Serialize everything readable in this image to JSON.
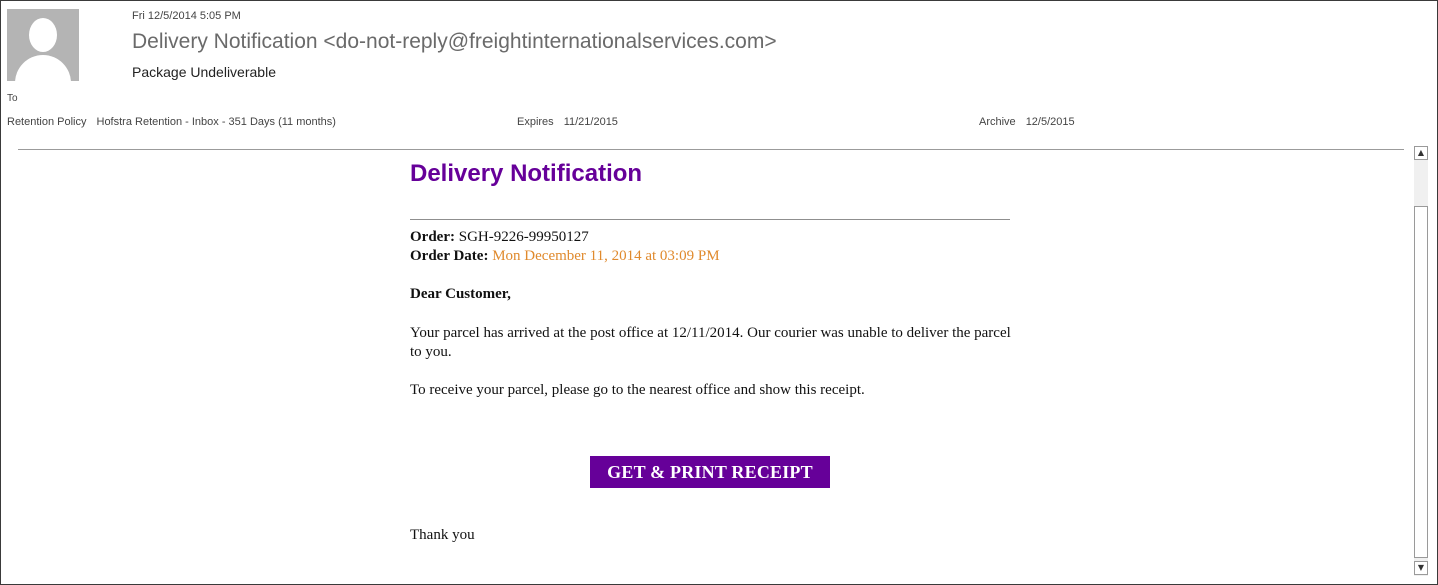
{
  "header": {
    "sent_date": "Fri 12/5/2014 5:05 PM",
    "from": "Delivery Notification <do-not-reply@freightinternationalservices.com>",
    "subject": "Package Undeliverable",
    "to_label": "To"
  },
  "meta": {
    "retention_label": "Retention Policy",
    "retention_value": "Hofstra Retention - Inbox - 351 Days (11 months)",
    "expires_label": "Expires",
    "expires_value": "11/21/2015",
    "archive_label": "Archive",
    "archive_value": "12/5/2015"
  },
  "message": {
    "title": "Delivery Notification",
    "order_label": "Order:",
    "order_value": "SGH-9226-99950127",
    "order_date_label": "Order Date:",
    "order_date_value": "Mon December 11, 2014 at 03:09 PM",
    "greeting": "Dear Customer,",
    "paragraph1": "Your parcel has arrived at the post office at 12/11/2014. Our courier was unable to deliver the parcel to you.",
    "paragraph2": "To receive your parcel, please go to the nearest office and show this receipt.",
    "button_label": "GET & PRINT RECEIPT",
    "closing": "Thank you"
  },
  "scrollbar": {
    "up_icon": "chevron-up-icon",
    "down_icon": "chevron-down-icon"
  },
  "colors": {
    "title_purple": "#660099",
    "button_purple": "#660099",
    "date_orange": "#e08a2d"
  }
}
